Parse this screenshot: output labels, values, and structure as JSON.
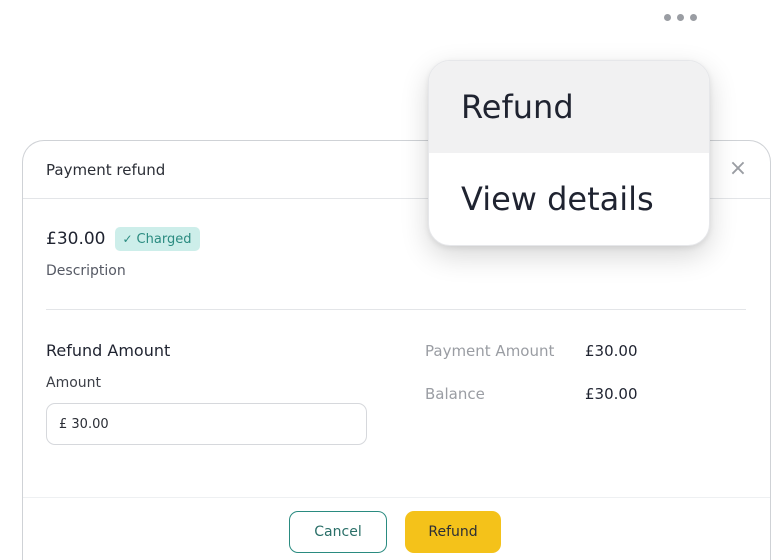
{
  "modal": {
    "title": "Payment refund",
    "close_glyph": "×",
    "amount": "£30.00",
    "status": {
      "label": "Charged",
      "check_glyph": "✓",
      "color": "#2a8b80",
      "background": "#cdeeea"
    },
    "description": "Description",
    "refund_section": {
      "title": "Refund Amount",
      "amount_label": "Amount",
      "amount_value": "£ 30.00"
    },
    "summary": {
      "payment_amount_label": "Payment Amount",
      "payment_amount_value": "£30.00",
      "balance_label": "Balance",
      "balance_value": "£30.00"
    },
    "footer": {
      "cancel_label": "Cancel",
      "refund_label": "Refund"
    }
  },
  "menu": {
    "items": [
      {
        "label": "Refund"
      },
      {
        "label": "View details"
      }
    ]
  },
  "colors": {
    "accent_yellow": "#f4c21a",
    "accent_teal": "#2a8b80"
  },
  "icons": {
    "more": "more-horizontal-icon",
    "close": "close-icon",
    "check": "check-icon"
  }
}
